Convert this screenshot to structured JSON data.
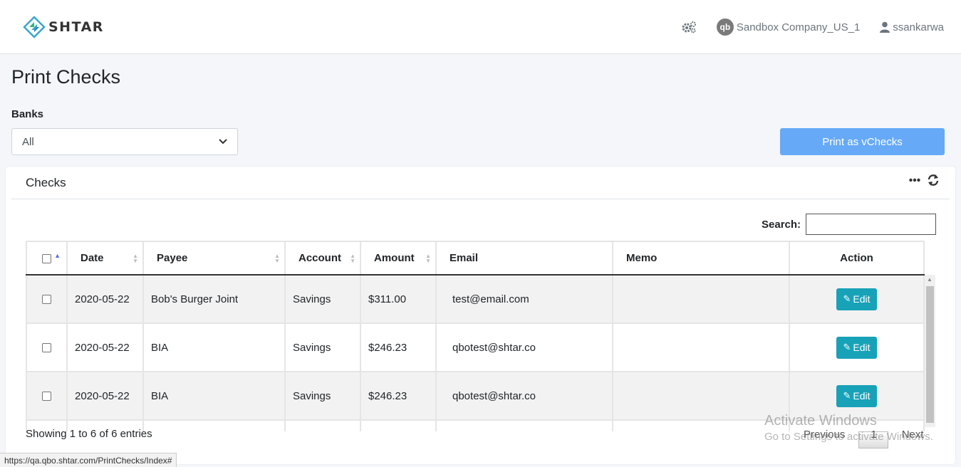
{
  "header": {
    "brand": "SHTAR",
    "company": "Sandbox Company_US_1",
    "company_icon_text": "qb",
    "user": "ssankarwa"
  },
  "page": {
    "title": "Print Checks",
    "banks_label": "Banks",
    "bank_selected": "All",
    "print_button": "Print as vChecks"
  },
  "card": {
    "title": "Checks",
    "search_label": "Search:"
  },
  "table": {
    "columns": [
      "Date",
      "Payee",
      "Account",
      "Amount",
      "Email",
      "Memo",
      "Action"
    ],
    "rows": [
      {
        "date": "2020-05-22",
        "payee": "Bob's Burger Joint",
        "account": "Savings",
        "amount": "$311.00",
        "email": "test@email.com",
        "memo": "",
        "action": "Edit"
      },
      {
        "date": "2020-05-22",
        "payee": "BIA",
        "account": "Savings",
        "amount": "$246.23",
        "email": "qbotest@shtar.co",
        "memo": "",
        "action": "Edit"
      },
      {
        "date": "2020-05-22",
        "payee": "BIA",
        "account": "Savings",
        "amount": "$246.23",
        "email": "qbotest@shtar.co",
        "memo": "",
        "action": "Edit"
      }
    ],
    "info": "Showing 1 to 6 of 6 entries",
    "pager": {
      "previous": "Previous",
      "page": "1",
      "next": "Next"
    }
  },
  "overlay": {
    "watermark_title": "Activate Windows",
    "watermark_sub": "Go to Settings to activate Windows.",
    "status_url": "https://qa.qbo.shtar.com/PrintChecks/Index#"
  },
  "colors": {
    "primary_light": "#66aaf7",
    "edit_button": "#17a2b8"
  }
}
